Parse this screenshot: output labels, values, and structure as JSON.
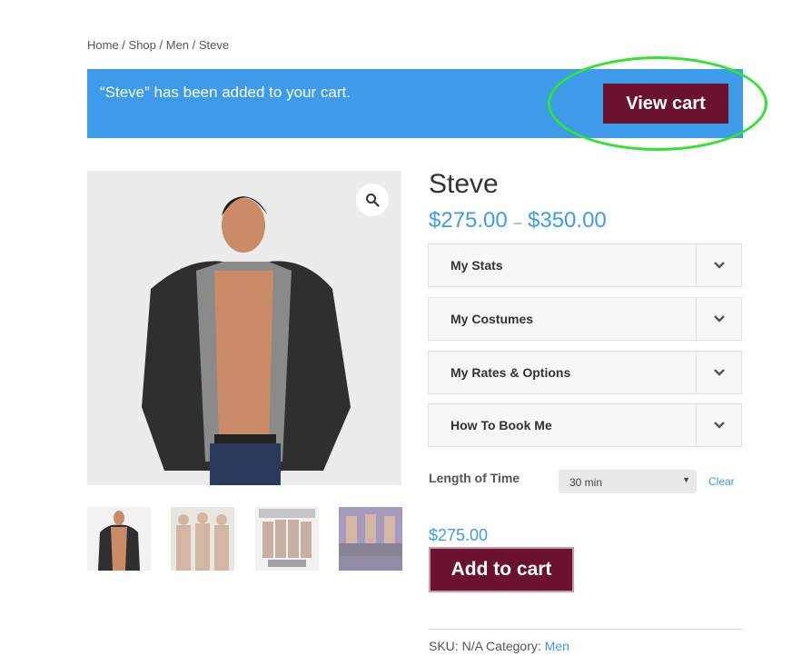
{
  "breadcrumb": {
    "home": "Home",
    "sep1": " / ",
    "shop": "Shop",
    "sep2": " / ",
    "men": "Men",
    "sep3": " / ",
    "current": "Steve"
  },
  "notice": {
    "message": "“Steve” has been added to your cart.",
    "button_label": "View cart"
  },
  "product": {
    "title": "Steve",
    "price_min": "$275.00",
    "price_sep": "–",
    "price_max": "$350.00",
    "main_image": "product-photo",
    "zoom_icon": "magnifier-icon",
    "thumbnails": [
      {
        "name": "thumbnail-1"
      },
      {
        "name": "thumbnail-2"
      },
      {
        "name": "thumbnail-3"
      },
      {
        "name": "thumbnail-4"
      }
    ],
    "accordions": [
      {
        "label": "My Stats"
      },
      {
        "label": "My Costumes"
      },
      {
        "label": "My Rates & Options"
      },
      {
        "label": "How To Book Me"
      }
    ],
    "variation": {
      "label": "Length of Time",
      "selected": "30 min",
      "clear_label": "Clear"
    },
    "variation_price": "$275.00",
    "add_to_cart_label": "Add to cart",
    "meta": {
      "sku_label": "SKU: ",
      "sku_value": "N/A",
      "category_label": " Category: ",
      "category_value": "Men"
    }
  },
  "colors": {
    "accent": "#3d9bea",
    "button": "#6b1230",
    "highlight": "#33e233"
  }
}
